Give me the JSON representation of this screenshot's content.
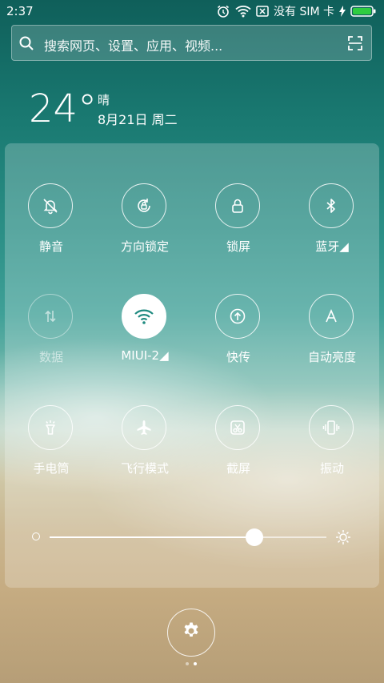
{
  "status_bar": {
    "time": "2:37",
    "sim_text": "没有 SIM 卡",
    "icons": [
      "alarm-icon",
      "wifi-icon",
      "sim-none-icon",
      "charging-icon",
      "battery-icon"
    ],
    "battery_color": "#2ecc40"
  },
  "search": {
    "placeholder": "搜索网页、设置、应用、视频..."
  },
  "weather": {
    "temperature": "24°",
    "condition": "晴",
    "date": "8月21日 周二"
  },
  "toggles": [
    {
      "id": "silent",
      "label": "静音",
      "icon": "bell-off-icon",
      "state": "off"
    },
    {
      "id": "rotation-lock",
      "label": "方向锁定",
      "icon": "rotation-lock-icon",
      "state": "off"
    },
    {
      "id": "lock-screen",
      "label": "锁屏",
      "icon": "lock-icon",
      "state": "off"
    },
    {
      "id": "bluetooth",
      "label": "蓝牙◢",
      "icon": "bluetooth-icon",
      "state": "off"
    },
    {
      "id": "data",
      "label": "数据",
      "icon": "data-arrows-icon",
      "state": "disabled"
    },
    {
      "id": "wifi",
      "label": "MIUI-2◢",
      "icon": "wifi-icon",
      "state": "on"
    },
    {
      "id": "quick-share",
      "label": "快传",
      "icon": "upload-icon",
      "state": "off"
    },
    {
      "id": "auto-brightness",
      "label": "自动亮度",
      "icon": "letter-a-icon",
      "state": "off"
    },
    {
      "id": "flashlight",
      "label": "手电筒",
      "icon": "flashlight-icon",
      "state": "off"
    },
    {
      "id": "airplane",
      "label": "飞行模式",
      "icon": "airplane-icon",
      "state": "off"
    },
    {
      "id": "screenshot",
      "label": "截屏",
      "icon": "scissors-icon",
      "state": "off"
    },
    {
      "id": "vibrate",
      "label": "振动",
      "icon": "vibrate-icon",
      "state": "off"
    }
  ],
  "brightness": {
    "value": 0.74,
    "min_icon": "brightness-low-icon",
    "max_icon": "brightness-high-icon"
  },
  "bottom": {
    "settings_icon": "gear-icon",
    "pages": 2,
    "active_page": 2
  }
}
